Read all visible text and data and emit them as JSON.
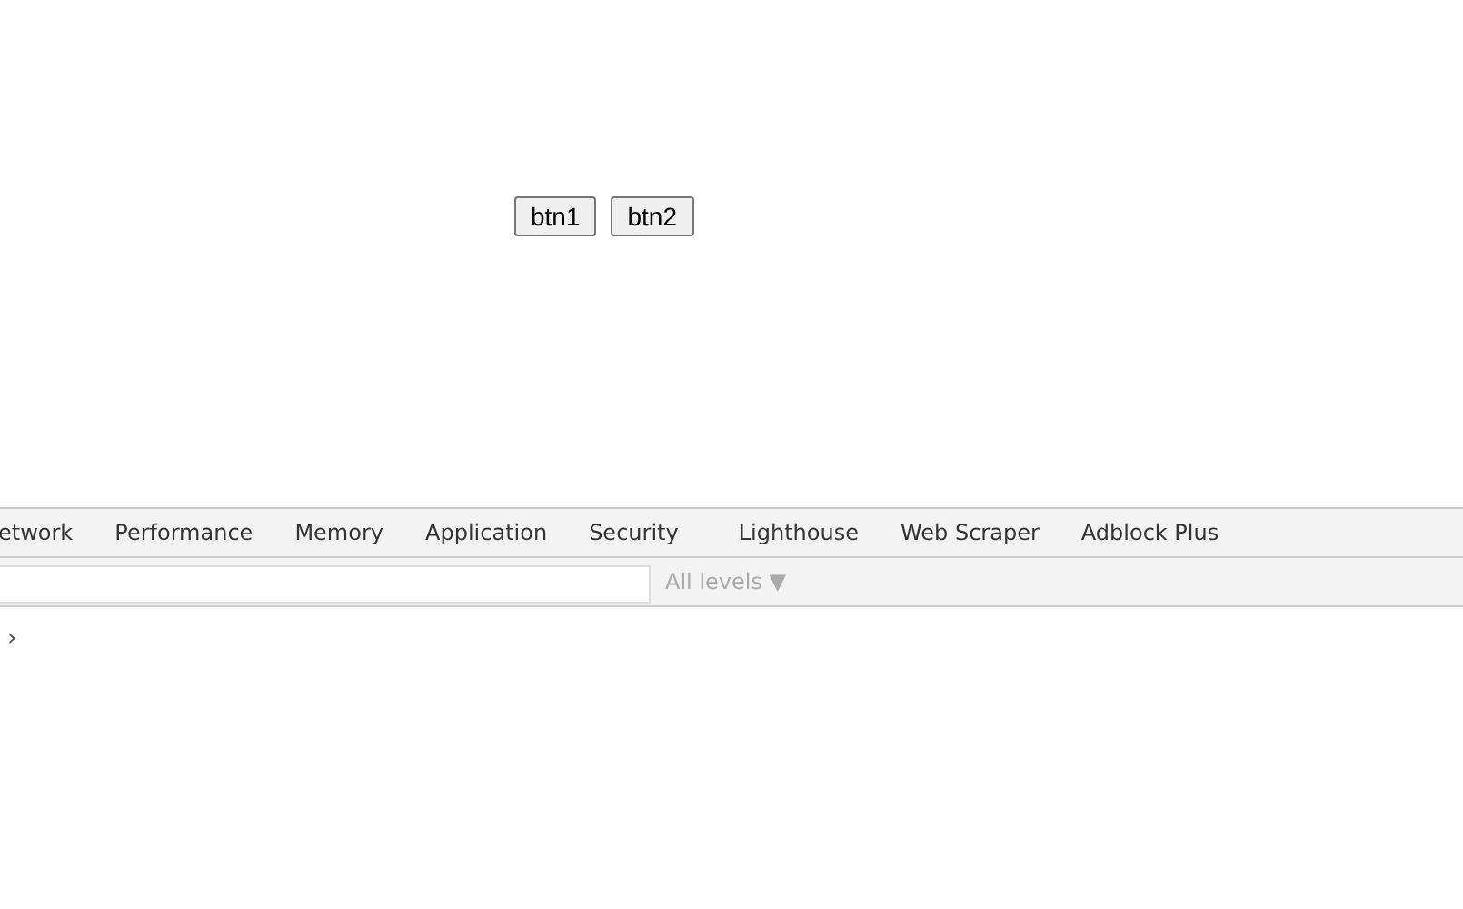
{
  "page": {
    "buttons": [
      "btn1",
      "btn2"
    ]
  },
  "devtools": {
    "tabs": [
      {
        "label": "etwork",
        "selected": false
      },
      {
        "label": "Performance",
        "selected": false
      },
      {
        "label": "Memory",
        "selected": false
      },
      {
        "label": "Application",
        "selected": false
      },
      {
        "label": "Security",
        "selected": false
      },
      {
        "label": "Lighthouse",
        "selected": false
      },
      {
        "label": "Web Scraper",
        "selected": false
      },
      {
        "label": "Adblock Plus",
        "selected": false
      }
    ],
    "filter": {
      "levels": "All levels",
      "caret": "▼"
    },
    "console": {
      "prompt": "›"
    }
  }
}
